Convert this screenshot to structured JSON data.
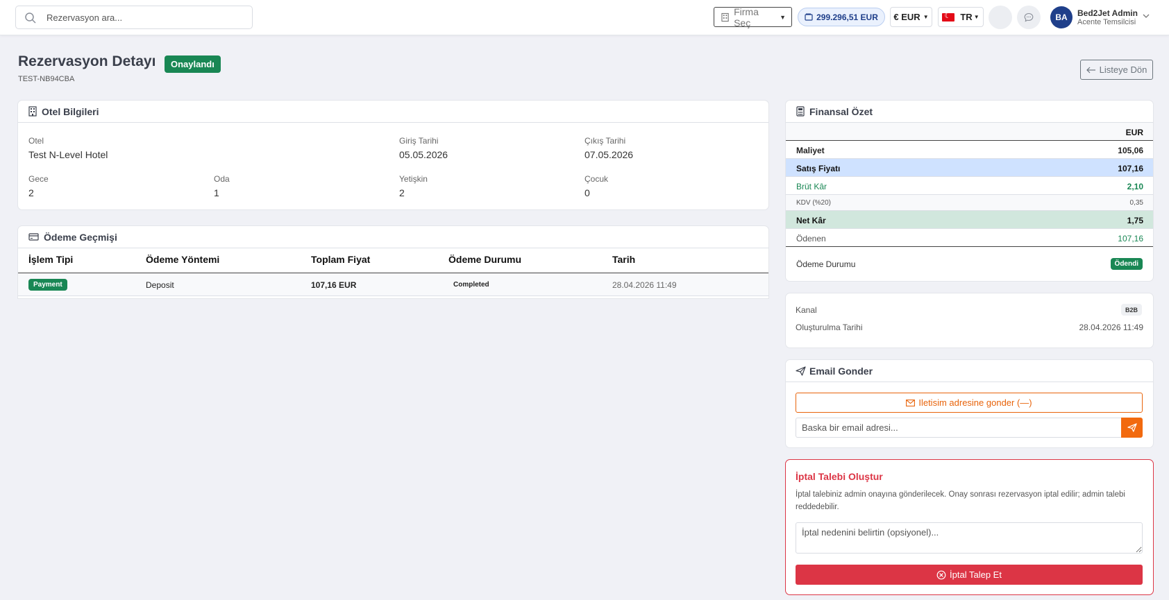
{
  "topbar": {
    "search_placeholder": "Rezervasyon ara...",
    "firma_label": "Firma Seç",
    "balance": "299.296,51 EUR",
    "currency": "€ EUR",
    "language": "TR",
    "user_name": "Bed2Jet Admin",
    "user_role": "Acente Temsilcisi",
    "user_initials": "BA"
  },
  "header": {
    "title": "Rezervasyon Detayı",
    "status": "Onaylandı",
    "reference": "TEST-NB94CBA",
    "back_label": "Listeye Dön"
  },
  "hotel": {
    "title": "Otel Bilgileri",
    "otel_label": "Otel",
    "otel_value": "Test N-Level Hotel",
    "giris_label": "Giriş Tarihi",
    "giris_value": "05.05.2026",
    "cikis_label": "Çıkış Tarihi",
    "cikis_value": "07.05.2026",
    "gece_label": "Gece",
    "gece_value": "2",
    "oda_label": "Oda",
    "oda_value": "1",
    "yetiskin_label": "Yetişkin",
    "yetiskin_value": "2",
    "cocuk_label": "Çocuk",
    "cocuk_value": "0"
  },
  "payments": {
    "title": "Ödeme Geçmişi",
    "columns": [
      "İşlem Tipi",
      "Ödeme Yöntemi",
      "Toplam Fiyat",
      "Ödeme Durumu",
      "Tarih"
    ],
    "rows": [
      {
        "type": "Payment",
        "method": "Deposit",
        "total": "107,16 EUR",
        "status": "Completed",
        "date": "28.04.2026 11:49"
      }
    ]
  },
  "finance": {
    "title": "Finansal Özet",
    "currency_header": "EUR",
    "maliyet_label": "Maliyet",
    "maliyet_value": "105,06",
    "satis_label": "Satış Fiyatı",
    "satis_value": "107,16",
    "brut_label": "Brüt Kâr",
    "brut_value": "2,10",
    "kdv_label": "KDV (%20)",
    "kdv_value": "0,35",
    "net_label": "Net Kâr",
    "net_value": "1,75",
    "odenen_label": "Ödenen",
    "odenen_value": "107,16",
    "odeme_durumu_label": "Ödeme Durumu",
    "odeme_durumu_value": "Ödendi"
  },
  "meta": {
    "kanal_label": "Kanal",
    "kanal_value": "B2B",
    "olusturma_label": "Oluşturulma Tarihi",
    "olusturma_value": "28.04.2026 11:49"
  },
  "email": {
    "title": "Email Gonder",
    "contact_button": "Iletisim adresine gonder (—)",
    "other_placeholder": "Baska bir email adresi..."
  },
  "cancel": {
    "title": "İptal Talebi Oluştur",
    "description": "İptal talebiniz admin onayına gönderilecek. Onay sonrası rezervasyon iptal edilir; admin talebi reddedebilir.",
    "reason_placeholder": "İptal nedenini belirtin (opsiyonel)...",
    "button": "İptal Talep Et"
  },
  "colors": {
    "primary": "#1f3f8a",
    "success": "#198754",
    "danger": "#dc3545",
    "orange": "#f26a0f",
    "background": "#f0f1f6"
  },
  "icons": [
    "search-icon",
    "building-icon",
    "wallet-icon",
    "chat-icon",
    "chevron-down-icon",
    "arrow-left-icon",
    "calculator-icon",
    "credit-card-icon",
    "send-icon",
    "envelope-icon",
    "x-circle-icon"
  ]
}
